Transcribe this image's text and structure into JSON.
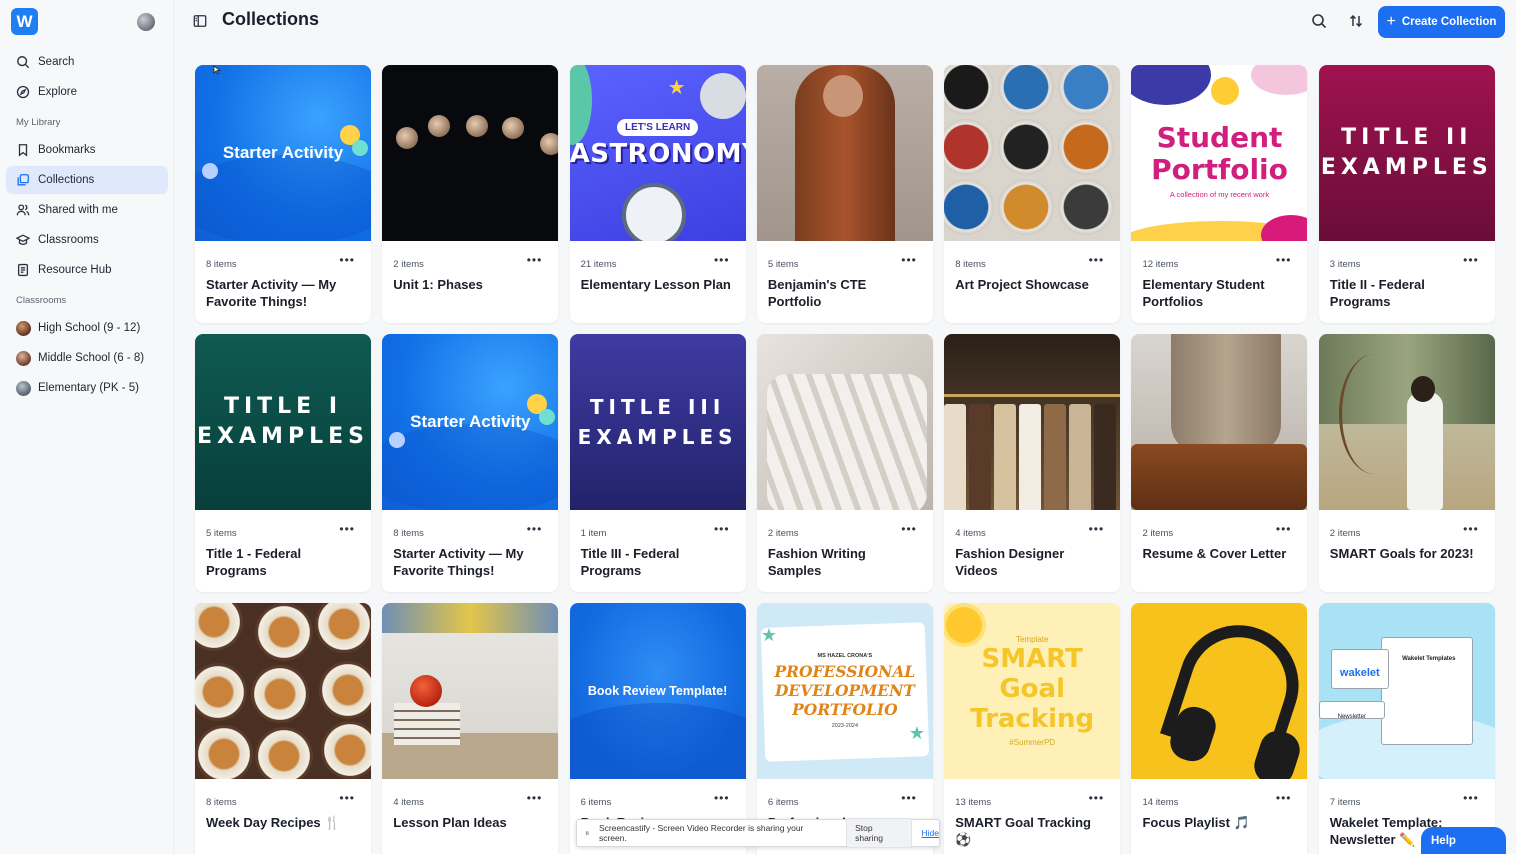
{
  "app": {
    "logo_letter": "W"
  },
  "sidebar": {
    "nav": [
      {
        "label": "Search",
        "icon": "search-icon"
      },
      {
        "label": "Explore",
        "icon": "compass-icon"
      }
    ],
    "my_library_label": "My Library",
    "library": [
      {
        "label": "Bookmarks",
        "icon": "bookmark-icon"
      },
      {
        "label": "Collections",
        "icon": "collections-icon",
        "active": true
      },
      {
        "label": "Shared with me",
        "icon": "users-icon"
      },
      {
        "label": "Classrooms",
        "icon": "graduation-cap-icon"
      },
      {
        "label": "Resource Hub",
        "icon": "document-icon"
      }
    ],
    "classrooms_label": "Classrooms",
    "classrooms": [
      {
        "label": "High School (9 - 12)",
        "color": "#7a4a32"
      },
      {
        "label": "Middle School (6 - 8)",
        "color": "#8c5a48"
      },
      {
        "label": "Elementary (PK - 5)",
        "color": "#7b8796"
      }
    ]
  },
  "header": {
    "title": "Collections",
    "create_label": "Create Collection"
  },
  "collections": [
    {
      "count": "8 items",
      "title": "Starter Activity — My Favorite Things!",
      "thumb_text": "Starter Activity",
      "style": "starter"
    },
    {
      "count": "2 items",
      "title": "Unit 1: Phases",
      "thumb_text": "",
      "style": "moon"
    },
    {
      "count": "21 items",
      "title": "Elementary Lesson Plan",
      "thumb_text": "ASTRONOMY",
      "thumb_sub": "LET'S LEARN",
      "style": "astro"
    },
    {
      "count": "5 items",
      "title": "Benjamin's CTE Portfolio",
      "thumb_text": "",
      "style": "coat"
    },
    {
      "count": "8 items",
      "title": "Art Project Showcase",
      "thumb_text": "",
      "style": "paint"
    },
    {
      "count": "12 items",
      "title": "Elementary Student Portfolios",
      "thumb_text": "Student Portfolio",
      "thumb_sub": "A collection of my recent work",
      "style": "student"
    },
    {
      "count": "3 items",
      "title": "Title II - Federal Programs",
      "thumb_text": "TITLE II EXAMPLES",
      "style": "title2"
    },
    {
      "count": "5 items",
      "title": "Title 1 - Federal Programs",
      "thumb_text": "TITLE I EXAMPLES",
      "style": "title1"
    },
    {
      "count": "8 items",
      "title": "Starter Activity — My Favorite Things!",
      "thumb_text": "Starter Activity",
      "style": "starter"
    },
    {
      "count": "1 item",
      "title": "Title III - Federal Programs",
      "thumb_text": "TITLE III EXAMPLES",
      "style": "title3"
    },
    {
      "count": "2 items",
      "title": "Fashion Writing Samples",
      "thumb_text": "",
      "style": "hanger"
    },
    {
      "count": "4 items",
      "title": "Fashion Designer Videos",
      "thumb_text": "",
      "style": "rack"
    },
    {
      "count": "2 items",
      "title": "Resume & Cover Letter",
      "thumb_text": "",
      "style": "suitcase"
    },
    {
      "count": "2 items",
      "title": "SMART Goals for 2023!",
      "thumb_text": "",
      "style": "archer"
    },
    {
      "count": "8 items",
      "title": "Week Day Recipes 🍴",
      "thumb_text": "",
      "style": "food"
    },
    {
      "count": "4 items",
      "title": "Lesson Plan Ideas",
      "thumb_text": "",
      "style": "apple"
    },
    {
      "count": "6 items",
      "title": "Book Review",
      "thumb_text": "Book Review Template!",
      "style": "book"
    },
    {
      "count": "6 items",
      "title": "Professional",
      "thumb_text": "PROFESSIONAL DEVELOPMENT PORTFOLIO",
      "thumb_sub": "MS HAZEL CRONA'S",
      "thumb_foot": "2023-2024",
      "style": "prof"
    },
    {
      "count": "13 items",
      "title": "SMART Goal Tracking ⚽",
      "thumb_text": "SMART Goal Tracking",
      "thumb_sub": "Template",
      "thumb_foot": "#SummerPD",
      "style": "smart"
    },
    {
      "count": "14 items",
      "title": "Focus Playlist 🎵",
      "thumb_text": "",
      "style": "headphones"
    },
    {
      "count": "7 items",
      "title": "Wakelet Template: Newsletter ✏️",
      "thumb_text": "wakelet",
      "thumb_sub": "Wakelet Templates",
      "thumb_foot": "Newsletter",
      "style": "wakelet"
    }
  ],
  "share_bar": {
    "message": "Screencastify - Screen Video Recorder is sharing your screen.",
    "stop_label": "Stop sharing",
    "hide_label": "Hide"
  },
  "help_label": "Help",
  "colors": {
    "accent": "#1d6ff2",
    "active_nav_bg": "#dfe9fb"
  }
}
